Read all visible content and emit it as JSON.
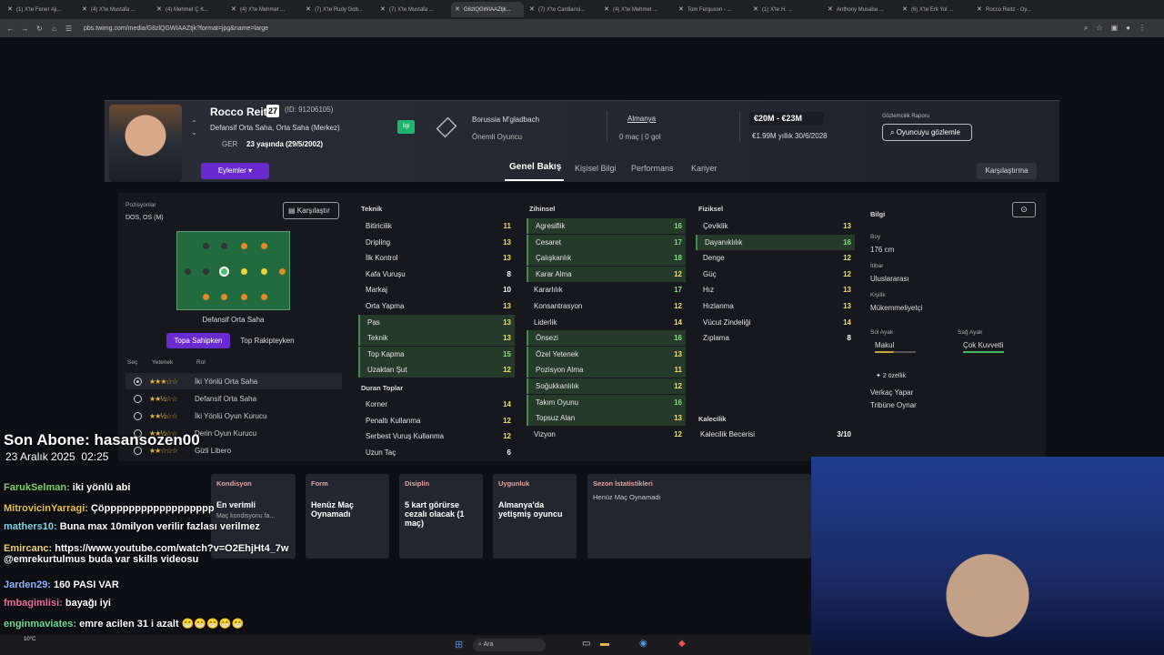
{
  "browser": {
    "tabs": [
      "(1) X'te Fener Aji...",
      "(4) X'te Mustafa ...",
      "(4) Mehmet Ç K...",
      "(4) X'te Mehmet ...",
      "(7) X'te Rudy Gob...",
      "(7) X'te Mustafa ...",
      "G8zlQGWIAAZtjk...",
      "(7) X'te Cardiansi...",
      "(4) X'te Mehmet ...",
      "Tom Ferguson - ...",
      "(1) X'te H. ...",
      "Anthony Musaba ...",
      "(6) X'te Erk Yol ...",
      "Rocco Reitz - Oy..."
    ],
    "active_tab": 6,
    "url": "pbs.twimg.com/media/G8zlQGWIAAZtjk?format=jpg&name=large"
  },
  "player": {
    "name": "Rocco Reitz",
    "number": "27",
    "id": "(ID: 91206105)",
    "positions": "Defansif Orta Saha, Orta Saha (Merkez)",
    "country": "GER",
    "age": "23 yaşında (29/5/2002)",
    "interest": "İlgi",
    "actions": "Eylemler",
    "club": "Borussia M'gladbach",
    "squad_status": "Önemli Oyuncu",
    "nation": "Almanya",
    "intl": "0 maç | 0 gol",
    "value": "€20M - €23M",
    "wage": "€1.99M yıllık",
    "contract": "30/6/2028",
    "scout_label": "Gözlemcilik Raporu",
    "scout_btn": "Oyuncuyu gözlemle"
  },
  "nav": {
    "tabs": [
      "Genel Bakış",
      "Kişisel Bilgi",
      "Performans",
      "Kariyer"
    ],
    "compare": "Karşılaştırma"
  },
  "left": {
    "positions_label": "Pozisyonlar",
    "positions": "DOS, OS (M)",
    "compare": "Karşılaştır",
    "pitch_role": "Defansif Orta Saha",
    "toggle": [
      "Topa Sahipken",
      "Top Rakipteyken"
    ],
    "cols": [
      "Seç",
      "Yetenek",
      "Rol"
    ],
    "roles": [
      {
        "stars": "★★★☆☆",
        "name": "İki Yönlü Orta Saha"
      },
      {
        "stars": "★★½☆☆",
        "name": "Defansif Orta Saha"
      },
      {
        "stars": "★★½☆☆",
        "name": "İki Yönlü Oyun Kurucu"
      },
      {
        "stars": "★★½☆☆",
        "name": "Derin Oyun Kurucu"
      },
      {
        "stars": "★★☆☆☆",
        "name": "Gizli Libero"
      }
    ]
  },
  "technical": {
    "title": "Teknik",
    "items": [
      [
        "Bitiricilik",
        "11"
      ],
      [
        "Dripling",
        "13"
      ],
      [
        "İlk Kontrol",
        "13"
      ],
      [
        "Kafa Vuruşu",
        "8"
      ],
      [
        "Markaj",
        "10"
      ],
      [
        "Orta Yapma",
        "13"
      ],
      [
        "Pas",
        "13"
      ],
      [
        "Teknik",
        "13"
      ],
      [
        "Top Kapma",
        "15"
      ],
      [
        "Uzaktan Şut",
        "12"
      ]
    ]
  },
  "setpieces": {
    "title": "Duran Toplar",
    "items": [
      [
        "Korner",
        "14"
      ],
      [
        "Penaltı Kullanma",
        "12"
      ],
      [
        "Serbest Vuruş Kullanma",
        "12"
      ],
      [
        "Uzun Taç",
        "6"
      ]
    ]
  },
  "mental": {
    "title": "Zihinsel",
    "items": [
      [
        "Agresiflik",
        "16"
      ],
      [
        "Cesaret",
        "17"
      ],
      [
        "Çalışkanlık",
        "18"
      ],
      [
        "Karar Alma",
        "12"
      ],
      [
        "Kararlılık",
        "17"
      ],
      [
        "Konsantrasyon",
        "12"
      ],
      [
        "Liderlik",
        "14"
      ],
      [
        "Önsezi",
        "16"
      ],
      [
        "Özel Yetenek",
        "13"
      ],
      [
        "Pozisyon Alma",
        "11"
      ],
      [
        "Soğukkanlılık",
        "12"
      ],
      [
        "Takım Oyunu",
        "16"
      ],
      [
        "Topsuz Alan",
        "13"
      ],
      [
        "Vizyon",
        "12"
      ]
    ]
  },
  "physical": {
    "title": "Fiziksel",
    "items": [
      [
        "Çeviklik",
        "13"
      ],
      [
        "Dayanıklılık",
        "16"
      ],
      [
        "Denge",
        "12"
      ],
      [
        "Güç",
        "12"
      ],
      [
        "Hız",
        "13"
      ],
      [
        "Hızlanma",
        "13"
      ],
      [
        "Vücut Zindeliği",
        "14"
      ],
      [
        "Zıplama",
        "8"
      ]
    ]
  },
  "goalkeeping": {
    "title": "Kalecilik",
    "items": [
      [
        "Kalecilik Becerisi",
        "3/10"
      ]
    ]
  },
  "info": {
    "title": "Bilgi",
    "height_label": "Boy",
    "height": "176 cm",
    "rep_label": "İtibar",
    "rep": "Uluslararası",
    "pers_label": "Kişilik",
    "pers": "Mükemmeliyetçi",
    "left_foot_label": "Sol Ayak",
    "left_foot": "Makul",
    "right_foot_label": "Sağ Ayak",
    "right_foot": "Çok Kuvvetli",
    "traits_count": "2 özellik",
    "traits": [
      "Verkaç Yapar",
      "Tribüne Oynar"
    ]
  },
  "cards": [
    {
      "t": "Kondisyon",
      "txt": "En verimli",
      "sub": "Maç kondisyonu fa..."
    },
    {
      "t": "Form",
      "txt": "Henüz Maç Oynamadı"
    },
    {
      "t": "Disiplin",
      "txt": "5 kart görürse cezalı olacak (1 maç)"
    },
    {
      "t": "Uygunluk",
      "txt": "Almanya'da yetişmiş oyuncu"
    },
    {
      "t": "Sezon İstatistikleri",
      "txt": "Henüz Maç Oynamadı"
    }
  ],
  "overlay": {
    "sub_label": "Son Abone: hasansozen00",
    "date": "23 Aralık 2025",
    "time": "02:25"
  },
  "chat": [
    {
      "u": "FarukSelman:",
      "m": " iki yönlü abi"
    },
    {
      "u": "MitrovicinYarragi:",
      "m": " Çöpppppppppppppppppp"
    },
    {
      "u": "mathers10:",
      "m": " Buna max 10milyon verilir fazlası verilmez"
    },
    {
      "u": "Emircanc:",
      "m": " https://www.youtube.com/watch?v=O2EhjHt4_7w @emrekurtulmus buda var skills videosu"
    },
    {
      "u": "Jarden29:",
      "m": " 160 PASI VAR"
    },
    {
      "u": "fmbagimlisi:",
      "m": " bayağı iyi"
    },
    {
      "u": "enginmaviates:",
      "m": " emre acilen 31 i azalt 😁😁😁😁😁"
    }
  ],
  "colors": {
    "accent": "#6b2ad0",
    "green": "#1fb36b",
    "highlight": "#263a2a"
  },
  "taskbar": {
    "search": "Ara",
    "weather": "10°C"
  }
}
